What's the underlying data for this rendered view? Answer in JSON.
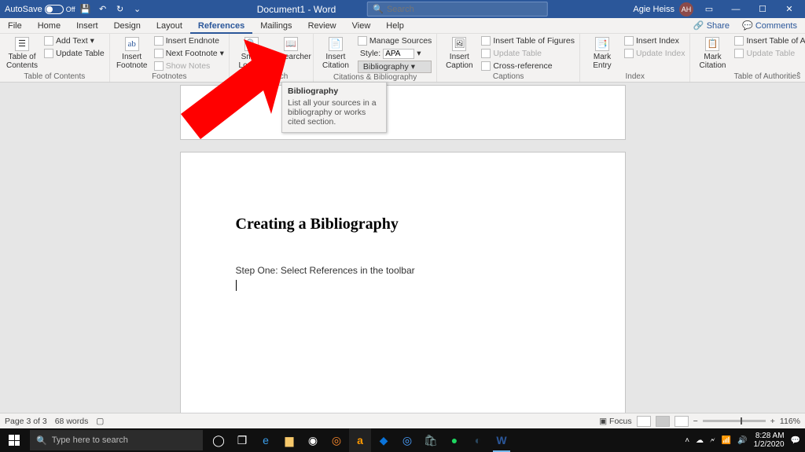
{
  "title_bar": {
    "autosave_label": "AutoSave",
    "autosave_state": "Off",
    "document_title": "Document1 - Word",
    "search_placeholder": "Search",
    "user_name": "Agie Heiss",
    "user_initials": "AH"
  },
  "tabs": {
    "items": [
      "File",
      "Home",
      "Insert",
      "Design",
      "Layout",
      "References",
      "Mailings",
      "Review",
      "View",
      "Help"
    ],
    "active_index": 5,
    "share_label": "Share",
    "comments_label": "Comments"
  },
  "ribbon": {
    "groups": {
      "toc": {
        "label": "Table of Contents",
        "big": "Table of\nContents",
        "add_text": "Add Text",
        "update_table": "Update Table"
      },
      "footnotes": {
        "label": "Footnotes",
        "big": "Insert\nFootnote",
        "big_icon": "ab",
        "insert_endnote": "Insert Endnote",
        "next_footnote": "Next Footnote",
        "show_notes": "Show Notes"
      },
      "research": {
        "label": "Research",
        "smart_lookup": "Smart\nLookup",
        "researcher": "Researcher"
      },
      "citations": {
        "label": "Citations & Bibliography",
        "insert_citation": "Insert\nCitation",
        "manage_sources": "Manage Sources",
        "style_label": "Style:",
        "style_value": "APA",
        "bibliography": "Bibliography"
      },
      "captions": {
        "label": "Captions",
        "insert_caption": "Insert\nCaption",
        "insert_tof": "Insert Table of Figures",
        "update_table": "Update Table",
        "cross_ref": "Cross-reference"
      },
      "index": {
        "label": "Index",
        "mark_entry": "Mark\nEntry",
        "insert_index": "Insert Index",
        "update_index": "Update Index"
      },
      "toa": {
        "label": "Table of Authorities",
        "mark_citation": "Mark\nCitation",
        "insert_toa": "Insert Table of Authorities",
        "update_table": "Update Table"
      }
    }
  },
  "tooltip": {
    "title": "Bibliography",
    "body": "List all your sources in a bibliography or works cited section."
  },
  "document": {
    "heading": "Creating a Bibliography",
    "line1": "Step One: Select References in the toolbar"
  },
  "status_bar": {
    "page_info": "Page 3 of 3",
    "word_count": "68 words",
    "focus_label": "Focus",
    "zoom_value": "116%"
  },
  "taskbar": {
    "search_placeholder": "Type here to search",
    "clock_time": "8:28 AM",
    "clock_date": "1/2/2020"
  }
}
